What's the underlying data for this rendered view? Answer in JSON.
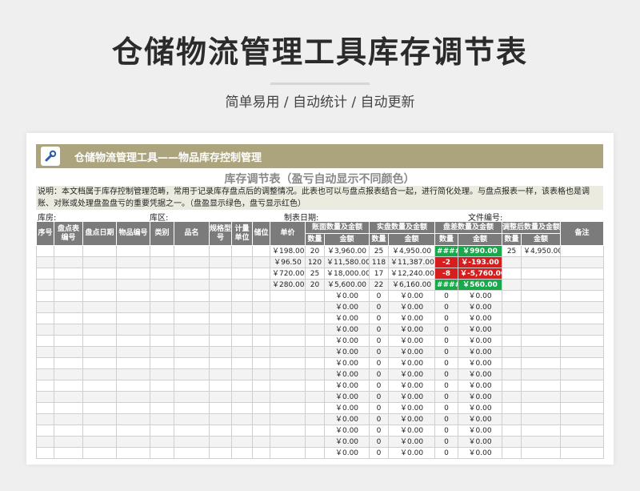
{
  "header": {
    "title": "仓储物流管理工具库存调节表",
    "subtitle": "简单易用 / 自动统计 / 自动更新"
  },
  "sheet": {
    "banner_title": "仓储物流管理工具——物品库存控制管理",
    "icon": "wrench-icon",
    "title": "库存调节表（盈亏自动显示不同颜色）",
    "description": "说明：本文档属于库存控制管理范畴，常用于记录库存盘点后的调整情况。此表也可以与盘点报表结合一起，进行简化处理。与盘点报表一样，该表格也是调账、对账或处理盘盈盘亏的重要凭据之一。（盘盈显示绿色，盘亏显示红色）",
    "meta": {
      "warehouse": "库房:",
      "area": "库区:",
      "date": "制表日期:",
      "file_no": "文件编号:"
    },
    "columns": {
      "seq": "序号",
      "sheet_no": "盘点表编号",
      "date": "盘点日期",
      "item_code": "物品编号",
      "category": "类别",
      "name": "品名",
      "spec": "规格型号",
      "unit": "计量单位",
      "location": "储位",
      "price": "单价",
      "book": "账面数量及金额",
      "actual": "实盘数量及金额",
      "diff": "盘差数量及金额",
      "adjusted": "调整后数量及金额",
      "remark": "备注",
      "qty": "数量",
      "amount": "金额"
    },
    "rows": [
      {
        "price": "￥198.00",
        "book_qty": "20",
        "book_amt": "￥3,960.00",
        "act_qty": "25",
        "act_amt": "￥4,950.00",
        "diff_qty": "####",
        "diff_amt": "￥990.00",
        "diff_sign": "pos",
        "adj_qty": "25",
        "adj_amt": "￥4,950.00"
      },
      {
        "price": "￥96.50",
        "book_qty": "120",
        "book_amt": "￥11,580.00",
        "act_qty": "118",
        "act_amt": "￥11,387.00",
        "diff_qty": "-2",
        "diff_amt": "￥-193.00",
        "diff_sign": "neg",
        "adj_qty": "",
        "adj_amt": ""
      },
      {
        "price": "￥720.00",
        "book_qty": "25",
        "book_amt": "￥18,000.00",
        "act_qty": "17",
        "act_amt": "￥12,240.00",
        "diff_qty": "-8",
        "diff_amt": "￥-5,760.00",
        "diff_sign": "neg",
        "adj_qty": "",
        "adj_amt": ""
      },
      {
        "price": "￥280.00",
        "book_qty": "20",
        "book_amt": "￥5,600.00",
        "act_qty": "22",
        "act_amt": "￥6,160.00",
        "diff_qty": "####",
        "diff_amt": "￥560.00",
        "diff_sign": "pos",
        "adj_qty": "",
        "adj_amt": ""
      }
    ],
    "empty_amount": "￥0.00",
    "empty_qty": "0",
    "empty_rows": 15
  }
}
